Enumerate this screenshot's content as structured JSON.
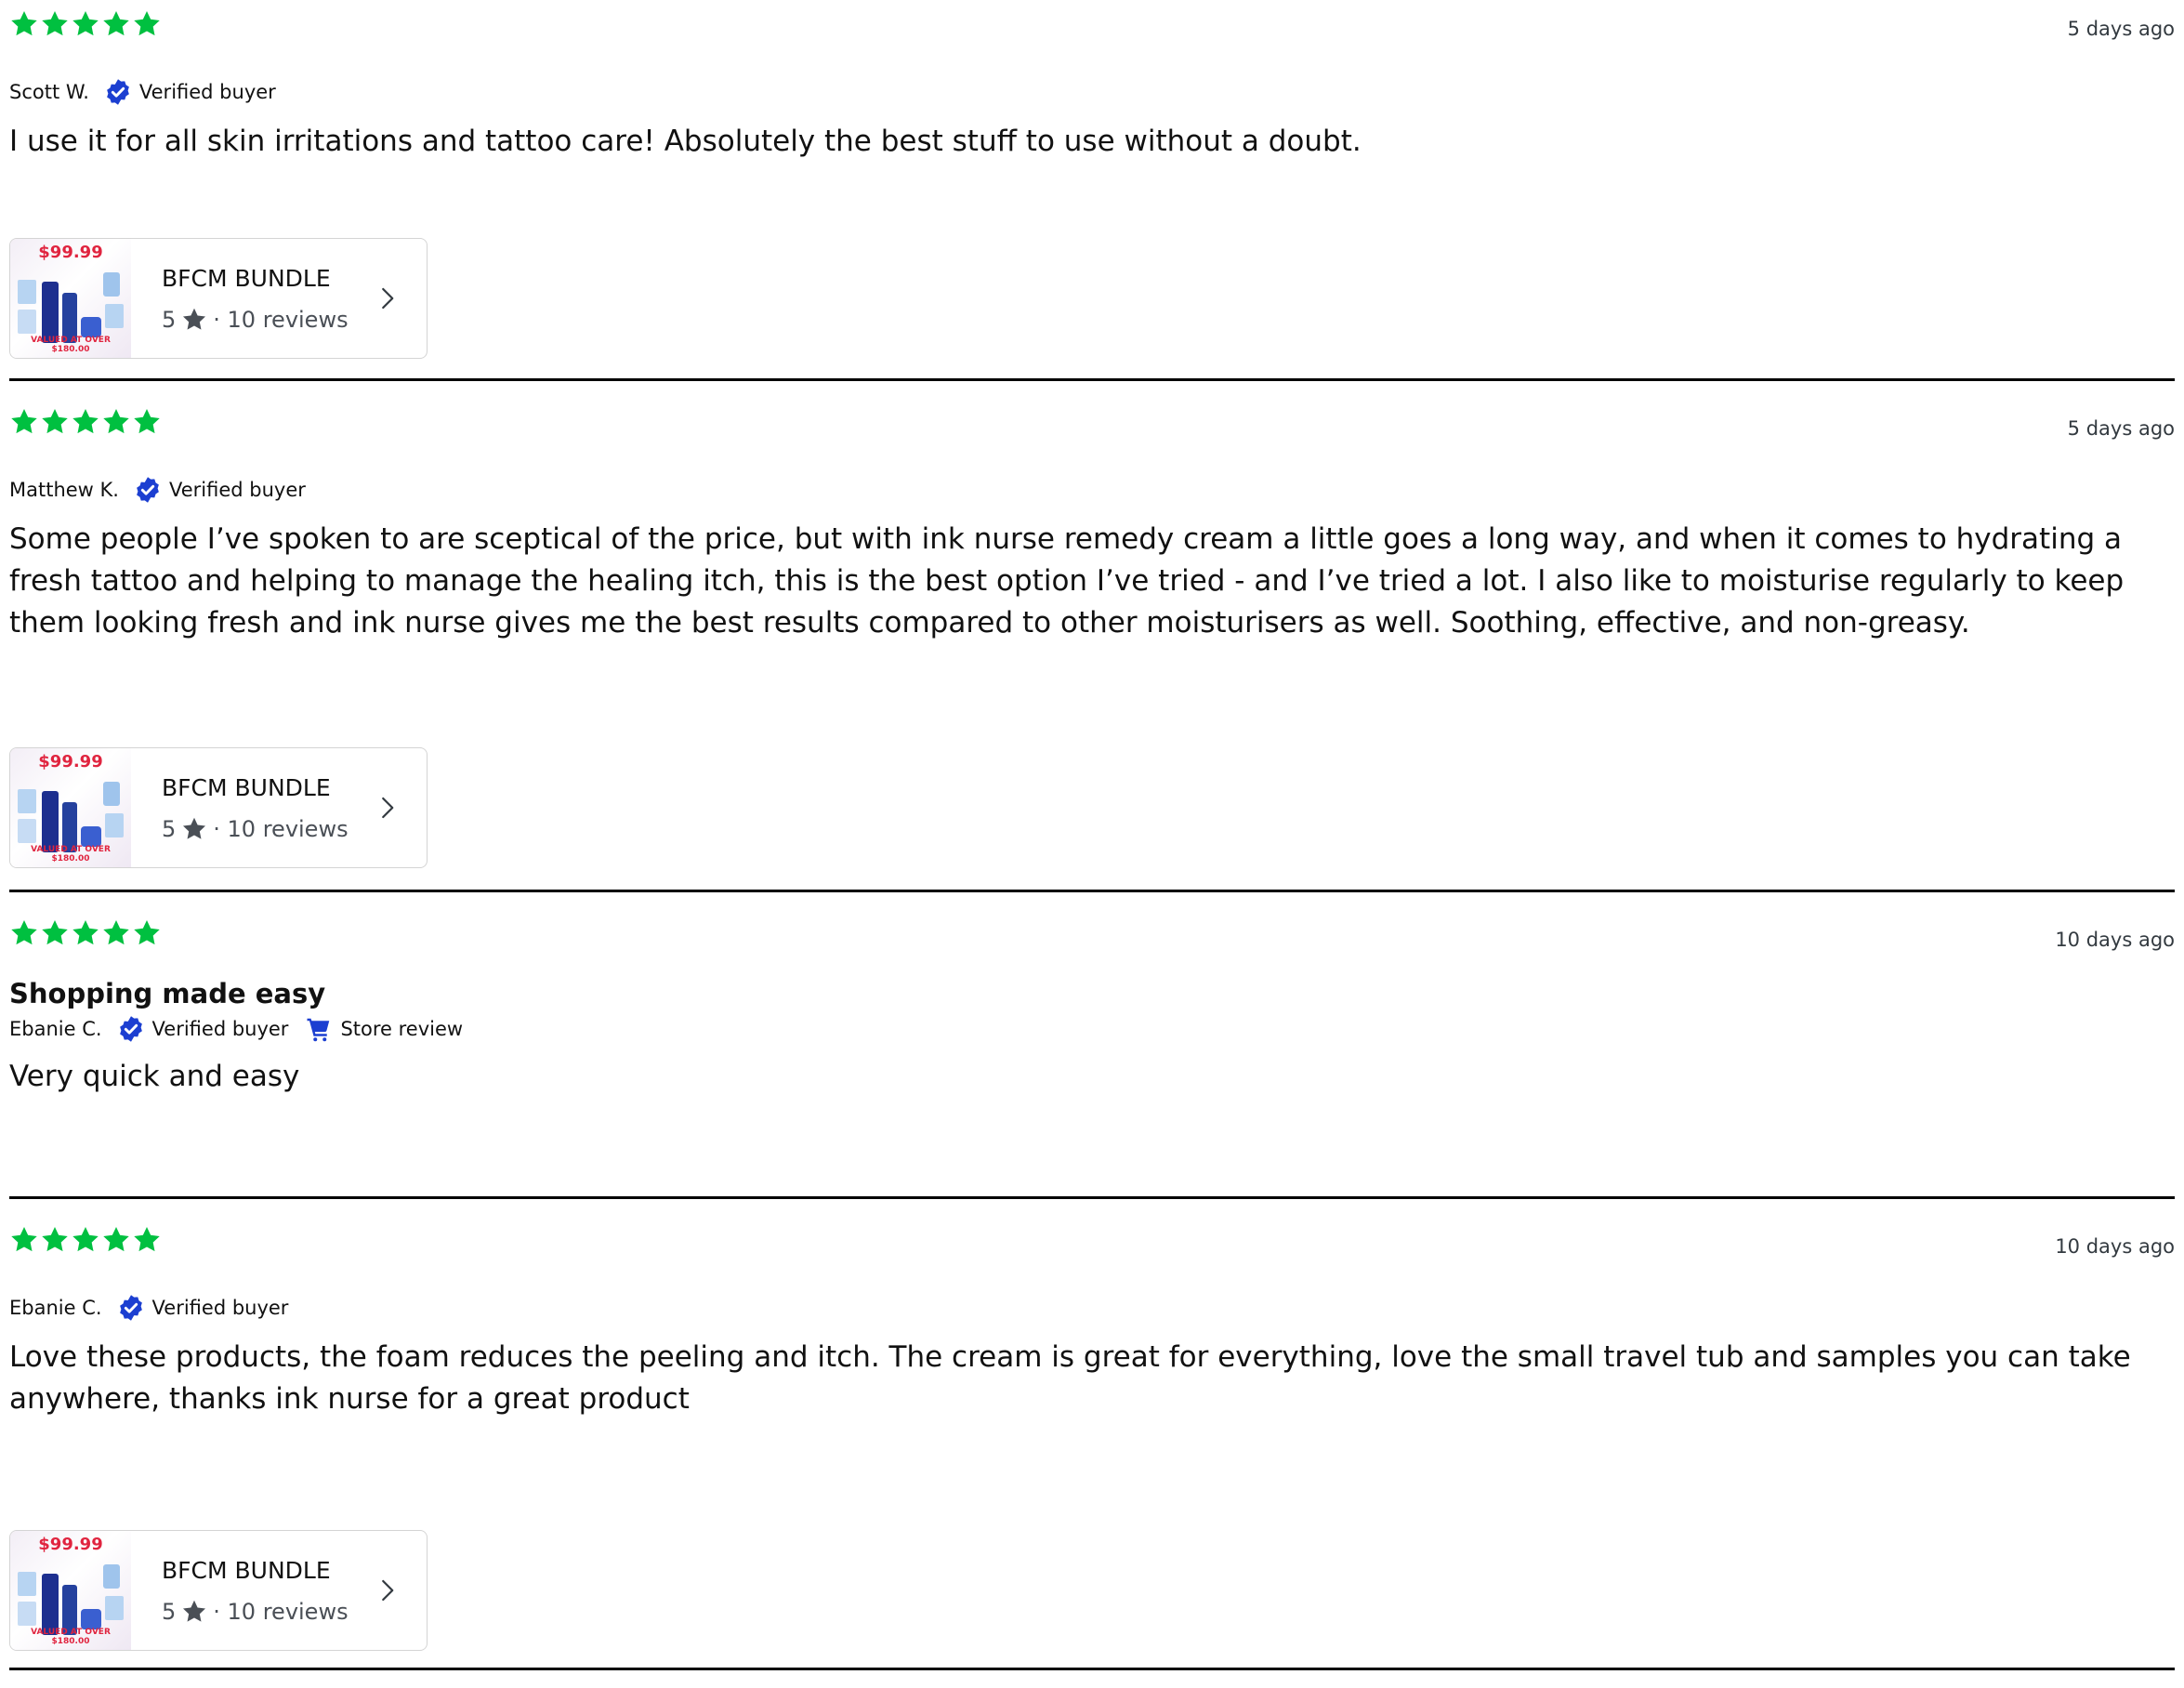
{
  "colors": {
    "star": "#00c040",
    "verified": "#1c3fd1",
    "divider": "#000000",
    "price_tag": "#e0243f"
  },
  "reviews": [
    {
      "rating": 5,
      "date": "5 days ago",
      "author": "Scott W.",
      "verified_label": "Verified buyer",
      "title": "",
      "body": "I use it for all skin irritations and tattoo care! Absolutely the best stuff to use without a doubt.",
      "product": {
        "name": "BFCM BUNDLE",
        "rating": "5",
        "reviews": "· 10 reviews",
        "image_price": "$99.99",
        "image_band": "VALUED AT OVER $180.00"
      }
    },
    {
      "rating": 5,
      "date": "5 days ago",
      "author": "Matthew K.",
      "verified_label": "Verified buyer",
      "title": "",
      "body": "Some people I’ve spoken to are sceptical of the price, but with ink nurse remedy cream a little goes a long way, and when it comes to hydrating a fresh tattoo and helping to manage the healing itch, this is the best option I’ve tried - and I’ve tried a lot. I also like to moisturise regularly to keep them looking fresh and ink nurse gives me the best results compared to other moisturisers as well. Soothing, effective, and non-greasy.",
      "product": {
        "name": "BFCM BUNDLE",
        "rating": "5",
        "reviews": "· 10 reviews",
        "image_price": "$99.99",
        "image_band": "VALUED AT OVER $180.00"
      }
    },
    {
      "rating": 5,
      "date": "10 days ago",
      "author": "Ebanie C.",
      "verified_label": "Verified buyer",
      "title": "Shopping made easy",
      "store_label": "Store review",
      "body": "Very quick and easy"
    },
    {
      "rating": 5,
      "date": "10 days ago",
      "author": "Ebanie C.",
      "verified_label": "Verified buyer",
      "title": "",
      "body": "Love these products, the foam reduces the peeling and itch. The cream is great for everything, love the small travel tub and samples you can take anywhere, thanks ink nurse for a great product",
      "product": {
        "name": "BFCM BUNDLE",
        "rating": "5",
        "reviews": "· 10 reviews",
        "image_price": "$99.99",
        "image_band": "VALUED AT OVER $180.00"
      }
    }
  ]
}
